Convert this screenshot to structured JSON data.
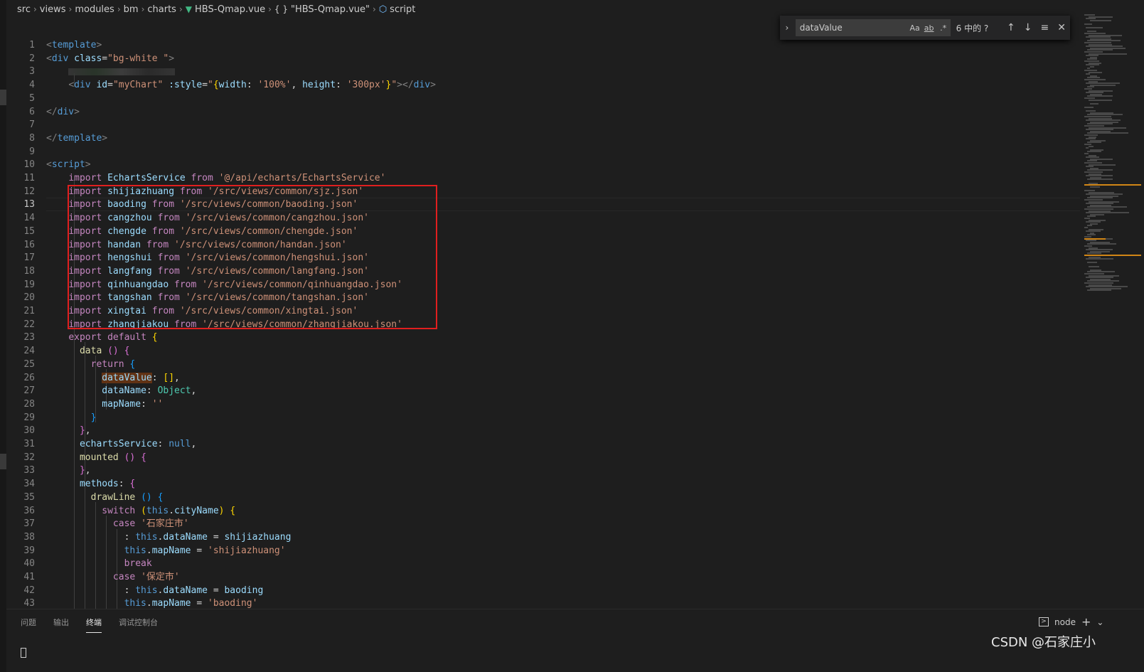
{
  "breadcrumb": [
    "src",
    "views",
    "modules",
    "bm",
    "charts",
    "HBS-Qmap.vue",
    "\"HBS-Qmap.vue\"",
    "script"
  ],
  "find": {
    "query": "dataValue",
    "opt_case": "Aa",
    "opt_word": "ab",
    "opt_regex": ".*",
    "count": "6 中的 ?"
  },
  "lines": [
    {
      "n": "1",
      "code": [
        [
          "t-tag",
          "<"
        ],
        [
          "t-tagname",
          "template"
        ],
        [
          "t-tag",
          ">"
        ]
      ]
    },
    {
      "n": "2",
      "code": [
        [
          "t-tag",
          "<"
        ],
        [
          "t-tagname",
          "div"
        ],
        [
          "t-def",
          " "
        ],
        [
          "t-attr",
          "class"
        ],
        [
          "t-def",
          "="
        ],
        [
          "t-str",
          "\"bg-white \""
        ],
        [
          "t-tag",
          ">"
        ]
      ]
    },
    {
      "n": "3",
      "code": [
        [
          "t-def",
          "    "
        ],
        [
          "blur",
          ""
        ]
      ]
    },
    {
      "n": "4",
      "code": [
        [
          "t-def",
          "    "
        ],
        [
          "t-tag",
          "<"
        ],
        [
          "t-tagname",
          "div"
        ],
        [
          "t-def",
          " "
        ],
        [
          "t-attr",
          "id"
        ],
        [
          "t-def",
          "="
        ],
        [
          "t-str",
          "\"myChart\""
        ],
        [
          "t-def",
          " "
        ],
        [
          "t-attr",
          ":style"
        ],
        [
          "t-def",
          "="
        ],
        [
          "t-str",
          "\""
        ],
        [
          "t-br1",
          "{"
        ],
        [
          "t-var",
          "width"
        ],
        [
          "t-def",
          ": "
        ],
        [
          "t-str",
          "'100%'"
        ],
        [
          "t-def",
          ", "
        ],
        [
          "t-var",
          "height"
        ],
        [
          "t-def",
          ": "
        ],
        [
          "t-str",
          "'300px'"
        ],
        [
          "t-br1",
          "}"
        ],
        [
          "t-str",
          "\""
        ],
        [
          "t-tag",
          "></"
        ],
        [
          "t-tagname",
          "div"
        ],
        [
          "t-tag",
          ">"
        ]
      ]
    },
    {
      "n": "5",
      "code": []
    },
    {
      "n": "6",
      "code": [
        [
          "t-tag",
          "</"
        ],
        [
          "t-tagname",
          "div"
        ],
        [
          "t-tag",
          ">"
        ]
      ]
    },
    {
      "n": "7",
      "code": []
    },
    {
      "n": "8",
      "code": [
        [
          "t-tag",
          "</"
        ],
        [
          "t-tagname",
          "template"
        ],
        [
          "t-tag",
          ">"
        ]
      ]
    },
    {
      "n": "9",
      "code": []
    },
    {
      "n": "10",
      "code": [
        [
          "t-tag",
          "<"
        ],
        [
          "t-tagname",
          "script"
        ],
        [
          "t-tag",
          ">"
        ]
      ]
    },
    {
      "n": "11",
      "code": [
        [
          "t-def",
          "    "
        ],
        [
          "t-kw",
          "import"
        ],
        [
          "t-def",
          " "
        ],
        [
          "t-var",
          "EchartsService"
        ],
        [
          "t-def",
          " "
        ],
        [
          "t-kw",
          "from"
        ],
        [
          "t-def",
          " "
        ],
        [
          "t-str",
          "'@/api/echarts/EchartsService'"
        ]
      ]
    },
    {
      "n": "12",
      "code": [
        [
          "t-def",
          "    "
        ],
        [
          "t-kw",
          "import"
        ],
        [
          "t-def",
          " "
        ],
        [
          "t-var",
          "shijiazhuang"
        ],
        [
          "t-def",
          " "
        ],
        [
          "t-kw",
          "from"
        ],
        [
          "t-def",
          " "
        ],
        [
          "t-str",
          "'/src/views/common/sjz.json'"
        ]
      ]
    },
    {
      "n": "13",
      "code": [
        [
          "t-def",
          "    "
        ],
        [
          "t-kw",
          "import"
        ],
        [
          "t-def",
          " "
        ],
        [
          "t-var",
          "baoding"
        ],
        [
          "t-def",
          " "
        ],
        [
          "t-kw",
          "from"
        ],
        [
          "t-def",
          " "
        ],
        [
          "t-str",
          "'/src/views/common/baoding.json'"
        ]
      ],
      "active": true
    },
    {
      "n": "14",
      "code": [
        [
          "t-def",
          "    "
        ],
        [
          "t-kw",
          "import"
        ],
        [
          "t-def",
          " "
        ],
        [
          "t-var",
          "cangzhou"
        ],
        [
          "t-def",
          " "
        ],
        [
          "t-kw",
          "from"
        ],
        [
          "t-def",
          " "
        ],
        [
          "t-str",
          "'/src/views/common/cangzhou.json'"
        ]
      ]
    },
    {
      "n": "15",
      "code": [
        [
          "t-def",
          "    "
        ],
        [
          "t-kw",
          "import"
        ],
        [
          "t-def",
          " "
        ],
        [
          "t-var",
          "chengde"
        ],
        [
          "t-def",
          " "
        ],
        [
          "t-kw",
          "from"
        ],
        [
          "t-def",
          " "
        ],
        [
          "t-str",
          "'/src/views/common/chengde.json'"
        ]
      ]
    },
    {
      "n": "16",
      "code": [
        [
          "t-def",
          "    "
        ],
        [
          "t-kw",
          "import"
        ],
        [
          "t-def",
          " "
        ],
        [
          "t-var",
          "handan"
        ],
        [
          "t-def",
          " "
        ],
        [
          "t-kw",
          "from"
        ],
        [
          "t-def",
          " "
        ],
        [
          "t-str",
          "'/src/views/common/handan.json'"
        ]
      ]
    },
    {
      "n": "17",
      "code": [
        [
          "t-def",
          "    "
        ],
        [
          "t-kw",
          "import"
        ],
        [
          "t-def",
          " "
        ],
        [
          "t-var",
          "hengshui"
        ],
        [
          "t-def",
          " "
        ],
        [
          "t-kw",
          "from"
        ],
        [
          "t-def",
          " "
        ],
        [
          "t-str",
          "'/src/views/common/hengshui.json'"
        ]
      ]
    },
    {
      "n": "18",
      "code": [
        [
          "t-def",
          "    "
        ],
        [
          "t-kw",
          "import"
        ],
        [
          "t-def",
          " "
        ],
        [
          "t-var",
          "langfang"
        ],
        [
          "t-def",
          " "
        ],
        [
          "t-kw",
          "from"
        ],
        [
          "t-def",
          " "
        ],
        [
          "t-str",
          "'/src/views/common/langfang.json'"
        ]
      ]
    },
    {
      "n": "19",
      "code": [
        [
          "t-def",
          "    "
        ],
        [
          "t-kw",
          "import"
        ],
        [
          "t-def",
          " "
        ],
        [
          "t-var",
          "qinhuangdao"
        ],
        [
          "t-def",
          " "
        ],
        [
          "t-kw",
          "from"
        ],
        [
          "t-def",
          " "
        ],
        [
          "t-str",
          "'/src/views/common/qinhuangdao.json'"
        ]
      ]
    },
    {
      "n": "20",
      "code": [
        [
          "t-def",
          "    "
        ],
        [
          "t-kw",
          "import"
        ],
        [
          "t-def",
          " "
        ],
        [
          "t-var",
          "tangshan"
        ],
        [
          "t-def",
          " "
        ],
        [
          "t-kw",
          "from"
        ],
        [
          "t-def",
          " "
        ],
        [
          "t-str",
          "'/src/views/common/tangshan.json'"
        ]
      ]
    },
    {
      "n": "21",
      "code": [
        [
          "t-def",
          "    "
        ],
        [
          "t-kw",
          "import"
        ],
        [
          "t-def",
          " "
        ],
        [
          "t-var",
          "xingtai"
        ],
        [
          "t-def",
          " "
        ],
        [
          "t-kw",
          "from"
        ],
        [
          "t-def",
          " "
        ],
        [
          "t-str",
          "'/src/views/common/xingtai.json'"
        ]
      ]
    },
    {
      "n": "22",
      "code": [
        [
          "t-def",
          "    "
        ],
        [
          "t-kw",
          "import"
        ],
        [
          "t-def",
          " "
        ],
        [
          "t-var",
          "zhangjiakou"
        ],
        [
          "t-def",
          " "
        ],
        [
          "t-kw",
          "from"
        ],
        [
          "t-def",
          " "
        ],
        [
          "t-str",
          "'/src/views/common/zhangjiakou.json'"
        ]
      ]
    },
    {
      "n": "23",
      "code": [
        [
          "t-def",
          "    "
        ],
        [
          "t-kw",
          "export"
        ],
        [
          "t-def",
          " "
        ],
        [
          "t-kw",
          "default"
        ],
        [
          "t-def",
          " "
        ],
        [
          "t-br1",
          "{"
        ]
      ]
    },
    {
      "n": "24",
      "code": [
        [
          "t-def",
          "      "
        ],
        [
          "t-fn",
          "data"
        ],
        [
          "t-def",
          " "
        ],
        [
          "t-br2",
          "()"
        ],
        [
          "t-def",
          " "
        ],
        [
          "t-br2",
          "{"
        ]
      ]
    },
    {
      "n": "25",
      "code": [
        [
          "t-def",
          "        "
        ],
        [
          "t-kw",
          "return"
        ],
        [
          "t-def",
          " "
        ],
        [
          "t-br3",
          "{"
        ]
      ]
    },
    {
      "n": "26",
      "code": [
        [
          "t-def",
          "          "
        ],
        [
          "t-var hl",
          "dataValue"
        ],
        [
          "t-def",
          ": "
        ],
        [
          "t-br1",
          "[]"
        ],
        [
          "t-def",
          ","
        ]
      ]
    },
    {
      "n": "27",
      "code": [
        [
          "t-def",
          "          "
        ],
        [
          "t-var",
          "dataName"
        ],
        [
          "t-def",
          ": "
        ],
        [
          "t-type",
          "Object"
        ],
        [
          "t-def",
          ","
        ]
      ]
    },
    {
      "n": "28",
      "code": [
        [
          "t-def",
          "          "
        ],
        [
          "t-var",
          "mapName"
        ],
        [
          "t-def",
          ": "
        ],
        [
          "t-str",
          "''"
        ]
      ]
    },
    {
      "n": "29",
      "code": [
        [
          "t-def",
          "        "
        ],
        [
          "t-br3",
          "}"
        ]
      ]
    },
    {
      "n": "30",
      "code": [
        [
          "t-def",
          "      "
        ],
        [
          "t-br2",
          "}"
        ],
        [
          "t-def",
          ","
        ]
      ]
    },
    {
      "n": "31",
      "code": [
        [
          "t-def",
          "      "
        ],
        [
          "t-var",
          "echartsService"
        ],
        [
          "t-def",
          ": "
        ],
        [
          "t-blue",
          "null"
        ],
        [
          "t-def",
          ","
        ]
      ]
    },
    {
      "n": "32",
      "code": [
        [
          "t-def",
          "      "
        ],
        [
          "t-fn",
          "mounted"
        ],
        [
          "t-def",
          " "
        ],
        [
          "t-br2",
          "()"
        ],
        [
          "t-def",
          " "
        ],
        [
          "t-br2",
          "{"
        ]
      ]
    },
    {
      "n": "33",
      "code": [
        [
          "t-def",
          "      "
        ],
        [
          "t-br2",
          "}"
        ],
        [
          "t-def",
          ","
        ]
      ]
    },
    {
      "n": "34",
      "code": [
        [
          "t-def",
          "      "
        ],
        [
          "t-var",
          "methods"
        ],
        [
          "t-def",
          ": "
        ],
        [
          "t-br2",
          "{"
        ]
      ]
    },
    {
      "n": "35",
      "code": [
        [
          "t-def",
          "        "
        ],
        [
          "t-fn",
          "drawLine"
        ],
        [
          "t-def",
          " "
        ],
        [
          "t-br3",
          "()"
        ],
        [
          "t-def",
          " "
        ],
        [
          "t-br3",
          "{"
        ]
      ]
    },
    {
      "n": "36",
      "code": [
        [
          "t-def",
          "          "
        ],
        [
          "t-kw",
          "switch"
        ],
        [
          "t-def",
          " "
        ],
        [
          "t-br1",
          "("
        ],
        [
          "t-blue",
          "this"
        ],
        [
          "t-def",
          "."
        ],
        [
          "t-var",
          "cityName"
        ],
        [
          "t-br1",
          ")"
        ],
        [
          "t-def",
          " "
        ],
        [
          "t-br1",
          "{"
        ]
      ]
    },
    {
      "n": "37",
      "code": [
        [
          "t-def",
          "            "
        ],
        [
          "t-kw",
          "case"
        ],
        [
          "t-def",
          " "
        ],
        [
          "t-str",
          "'石家庄市'"
        ]
      ]
    },
    {
      "n": "38",
      "code": [
        [
          "t-def",
          "              : "
        ],
        [
          "t-blue",
          "this"
        ],
        [
          "t-def",
          "."
        ],
        [
          "t-var",
          "dataName"
        ],
        [
          "t-def",
          " = "
        ],
        [
          "t-var",
          "shijiazhuang"
        ]
      ]
    },
    {
      "n": "39",
      "code": [
        [
          "t-def",
          "              "
        ],
        [
          "t-blue",
          "this"
        ],
        [
          "t-def",
          "."
        ],
        [
          "t-var",
          "mapName"
        ],
        [
          "t-def",
          " = "
        ],
        [
          "t-str",
          "'shijiazhuang'"
        ]
      ]
    },
    {
      "n": "40",
      "code": [
        [
          "t-def",
          "              "
        ],
        [
          "t-kw",
          "break"
        ]
      ]
    },
    {
      "n": "41",
      "code": [
        [
          "t-def",
          "            "
        ],
        [
          "t-kw",
          "case"
        ],
        [
          "t-def",
          " "
        ],
        [
          "t-str",
          "'保定市'"
        ]
      ]
    },
    {
      "n": "42",
      "code": [
        [
          "t-def",
          "              : "
        ],
        [
          "t-blue",
          "this"
        ],
        [
          "t-def",
          "."
        ],
        [
          "t-var",
          "dataName"
        ],
        [
          "t-def",
          " = "
        ],
        [
          "t-var",
          "baoding"
        ]
      ]
    },
    {
      "n": "43",
      "code": [
        [
          "t-def",
          "              "
        ],
        [
          "t-blue",
          "this"
        ],
        [
          "t-def",
          "."
        ],
        [
          "t-var",
          "mapName"
        ],
        [
          "t-def",
          " = "
        ],
        [
          "t-str",
          "'baoding'"
        ]
      ]
    }
  ],
  "panel": {
    "tabs": [
      "问题",
      "输出",
      "终端",
      "调试控制台"
    ],
    "active_tab": "终端",
    "terminal_name": "node",
    "add_label": "+",
    "dropdown_label": "⌄"
  },
  "watermark": "CSDN @石家庄小"
}
